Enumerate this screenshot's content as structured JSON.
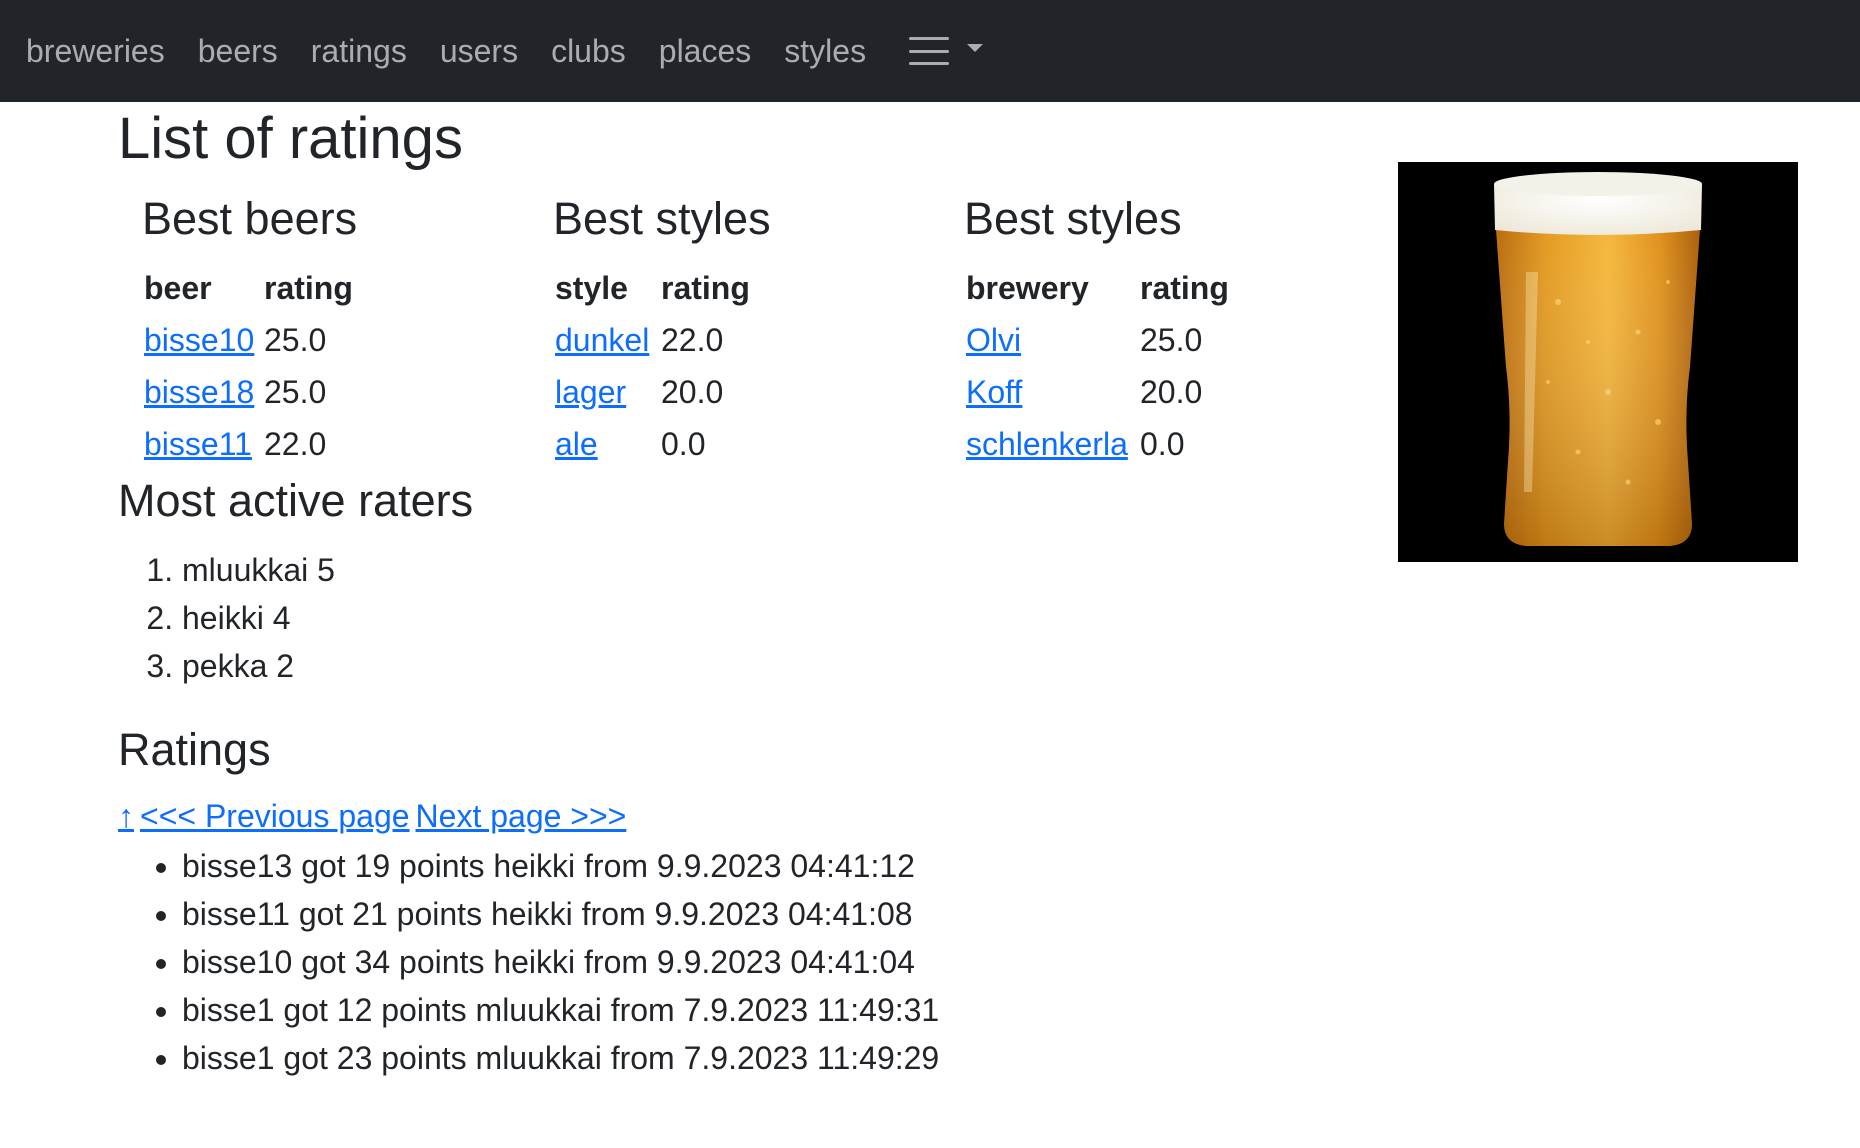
{
  "navbar": {
    "links": [
      {
        "label": "breweries"
      },
      {
        "label": "beers"
      },
      {
        "label": "ratings"
      },
      {
        "label": "users"
      },
      {
        "label": "clubs"
      },
      {
        "label": "places"
      },
      {
        "label": "styles"
      }
    ],
    "menu_icon": "hamburger-icon",
    "dropdown_icon": "caret-down-icon"
  },
  "page": {
    "title": "List of ratings"
  },
  "best_beers": {
    "title": "Best beers",
    "headers": [
      "beer",
      "rating"
    ],
    "rows": [
      {
        "name": "bisse10",
        "rating": "25.0"
      },
      {
        "name": "bisse18",
        "rating": "25.0"
      },
      {
        "name": "bisse11",
        "rating": "22.0"
      }
    ]
  },
  "best_styles": {
    "title": "Best styles",
    "headers": [
      "style",
      "rating"
    ],
    "rows": [
      {
        "name": "dunkel",
        "rating": "22.0"
      },
      {
        "name": "lager",
        "rating": "20.0"
      },
      {
        "name": "ale",
        "rating": "0.0"
      }
    ]
  },
  "best_breweries": {
    "title": "Best styles",
    "headers": [
      "brewery",
      "rating"
    ],
    "rows": [
      {
        "name": "Olvi",
        "rating": "25.0"
      },
      {
        "name": "Koff",
        "rating": "20.0"
      },
      {
        "name": "schlenkerla",
        "rating": "0.0"
      }
    ]
  },
  "active_raters": {
    "title": "Most active raters",
    "items": [
      {
        "text": "mluukkai 5"
      },
      {
        "text": "heikki 4"
      },
      {
        "text": "pekka 2"
      }
    ]
  },
  "ratings": {
    "title": "Ratings",
    "sort_arrow": "↑",
    "previous_label": "<<< Previous page",
    "next_label": "Next page >>>",
    "items": [
      {
        "text": "bisse13 got 19 points heikki from 9.9.2023 04:41:12"
      },
      {
        "text": "bisse11 got 21 points heikki from 9.9.2023 04:41:08"
      },
      {
        "text": "bisse10 got 34 points heikki from 9.9.2023 04:41:04"
      },
      {
        "text": "bisse1 got 12 points mluukkai from 7.9.2023 11:49:31"
      },
      {
        "text": "bisse1 got 23 points mluukkai from 7.9.2023 11:49:29"
      }
    ]
  },
  "colors": {
    "navbar_bg": "#212529",
    "link": "#0d6efd",
    "text": "#212529"
  }
}
